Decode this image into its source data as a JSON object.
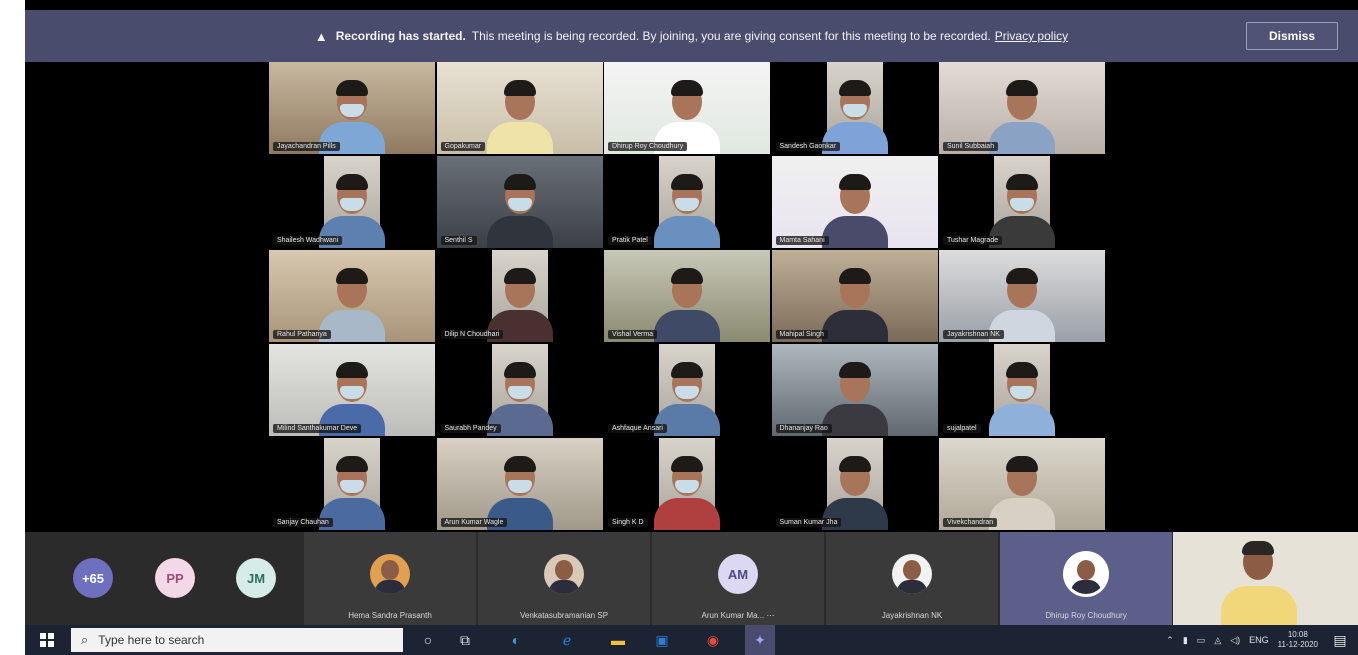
{
  "banner": {
    "strong": "Recording has started.",
    "message": "This meeting is being recorded. By joining, you are giving consent for this meeting to be recorded.",
    "link": "Privacy policy",
    "dismiss": "Dismiss"
  },
  "grid": [
    "Jayachandran Pills",
    "Gopakumar",
    "Dhirup Roy Choudhury",
    "Sandesh Gaonkar",
    "Sunil Subbaiah",
    "Shailesh Wadhwani",
    "Senthil S",
    "Pratik Patel",
    "Mamta Sahani",
    "Tushar Magrade",
    "Rahul Pathariya",
    "Dilip N Choudhari",
    "Vishal Verma",
    "Mahipal Singh",
    "Jayakrishnan NK",
    "Milind Santhakumar Deve",
    "Saurabh Pandey",
    "Ashfaque Ansari",
    "Dhananjay Rao",
    "sujalpatel",
    "Sanjay Chauhan",
    "Arun Kumar Wagle",
    "Singh K D",
    "Suman Kumar Jha",
    "Vivekchandran"
  ],
  "strip": {
    "overflow": "+65",
    "initials": [
      "PP",
      "JM"
    ],
    "tiles": [
      "Hema Sandra Prasanth",
      "Venkatasubramanian SP",
      "Arun Kumar Ma...",
      "Jayakrishnan NK",
      "Dhirup Roy Choudhury"
    ],
    "am_initials": "AM",
    "more": "⋯"
  },
  "taskbar": {
    "search_placeholder": "Type here to search",
    "lang": "ENG",
    "time": "10:08",
    "date": "11-12-2020"
  },
  "colors": {
    "banner": "#4a4c6e",
    "overflow_circle": "#6f6fc0",
    "pp_circle": "#f3d9e8",
    "jm_circle": "#d5ece8",
    "selected_tile": "#5b5f8a"
  }
}
